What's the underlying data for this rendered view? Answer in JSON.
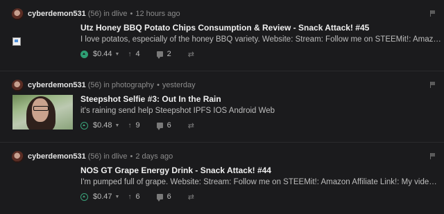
{
  "posts": [
    {
      "author": "cyberdemon531",
      "reputation": "(56)",
      "category_prefix": "in",
      "category": "dlive",
      "time": "12 hours ago",
      "title": "Utz Honey BBQ Potato Chips Consumption & Review - Snack Attack! #45",
      "body": "I love potatos, especially of the honey BBQ variety. Website: Stream: Follow me on STEEMit!: Amazon Affiliate Link!: My video is at DLive",
      "payout": "$0.44",
      "votes": "4",
      "comments": "2",
      "voted": true,
      "thumb": "broken"
    },
    {
      "author": "cyberdemon531",
      "reputation": "(56)",
      "category_prefix": "in",
      "category": "photography",
      "time": "yesterday",
      "title": "Steepshot Selfie #3: Out In the Rain",
      "body": "it's raining send help Steepshot IPFS IOS Android Web",
      "payout": "$0.48",
      "votes": "9",
      "comments": "6",
      "voted": false,
      "thumb": "selfie"
    },
    {
      "author": "cyberdemon531",
      "reputation": "(56)",
      "category_prefix": "in",
      "category": "dlive",
      "time": "2 days ago",
      "title": "NOS GT Grape Energy Drink - Snack Attack! #44",
      "body": "I'm pumped full of grape. Website: Stream: Follow me on STEEMit!: Amazon Affiliate Link!: My video is at DLive",
      "payout": "$0.47",
      "votes": "6",
      "comments": "6",
      "voted": false,
      "thumb": "none"
    }
  ],
  "separator": "•",
  "colors": {
    "background": "#1b1b1d",
    "upvote": "#2e9e73",
    "title": "#f0f0f0"
  },
  "icons": {
    "upvote": "upvote-icon",
    "flag": "flag-icon",
    "comments": "comment-icon",
    "resteem": "resteem-icon",
    "dropdown": "caret-down-icon"
  }
}
